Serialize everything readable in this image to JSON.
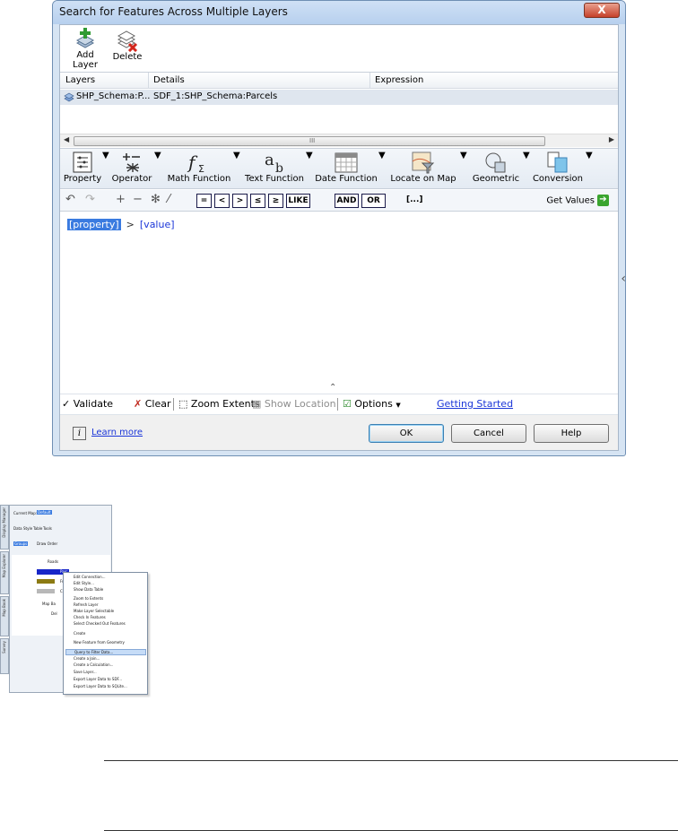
{
  "dialog": {
    "title": "Search for Features Across Multiple Layers",
    "close_label": "X"
  },
  "toolbar": {
    "add_layer_label": "Add Layer",
    "delete_label": "Delete"
  },
  "layers_table": {
    "headers": [
      "Layers",
      "Details",
      "Expression"
    ],
    "rows": [
      {
        "layer": "SHP_Schema:P...",
        "details": "SDF_1:SHP_Schema:Parcels",
        "expression": ""
      }
    ],
    "scroll_center": "III"
  },
  "function_toolbar": {
    "items": [
      "Property",
      "Operator",
      "Math Function",
      "Text Function",
      "Date Function",
      "Locate on Map",
      "Geometric",
      "Conversion"
    ]
  },
  "operator_bar": {
    "operators": [
      "=",
      "<",
      ">",
      "≤",
      "≥",
      "LIKE",
      "AND",
      "OR",
      "[...]"
    ],
    "get_values_label": "Get Values"
  },
  "expression": {
    "property_token": "[property]",
    "operator_token": ">",
    "value_token": "[value]"
  },
  "bottom_bar": {
    "validate": "Validate",
    "clear": "Clear",
    "zoom_extents": "Zoom Extents",
    "show_location": "Show Location",
    "options": "Options",
    "getting_started": "Getting Started"
  },
  "footer": {
    "info_glyph": "i",
    "learn_more": "Learn more",
    "ok": "OK",
    "cancel": "Cancel",
    "help": "Help"
  },
  "thumbnail": {
    "current_map_label": "Current Map:",
    "current_map_value": "Default",
    "toolbar_items": [
      "Data",
      "Style",
      "Table",
      "Tools"
    ],
    "view_label": "Groups",
    "draw_order": "Draw Order",
    "tabs": [
      "Display Manager",
      "Map Explorer",
      "Map Book",
      "Survey"
    ],
    "layers": [
      "Roads",
      "Parc",
      "Frec",
      "City",
      "Map Ba",
      "Del"
    ],
    "context_menu": [
      "Edit Connection...",
      "Edit Style...",
      "Show Data Table",
      "Zoom to Extents",
      "Refresh Layer",
      "Make Layer Selectable",
      "Check In Features",
      "Select Checked Out Features",
      "Create",
      "New Feature from Geometry",
      "Query to Filter Data...",
      "Create a Join...",
      "Create a Calculation...",
      "Save Layer...",
      "Export Layer Data to SDF...",
      "Export Layer Data to SQLite..."
    ],
    "highlighted_item": "Query to Filter Data..."
  },
  "colors": {
    "title_bar": "#b7d0ee",
    "selection": "#3a7be0",
    "link": "#1b36d8",
    "get_values_arrow": "#3aa52f"
  }
}
